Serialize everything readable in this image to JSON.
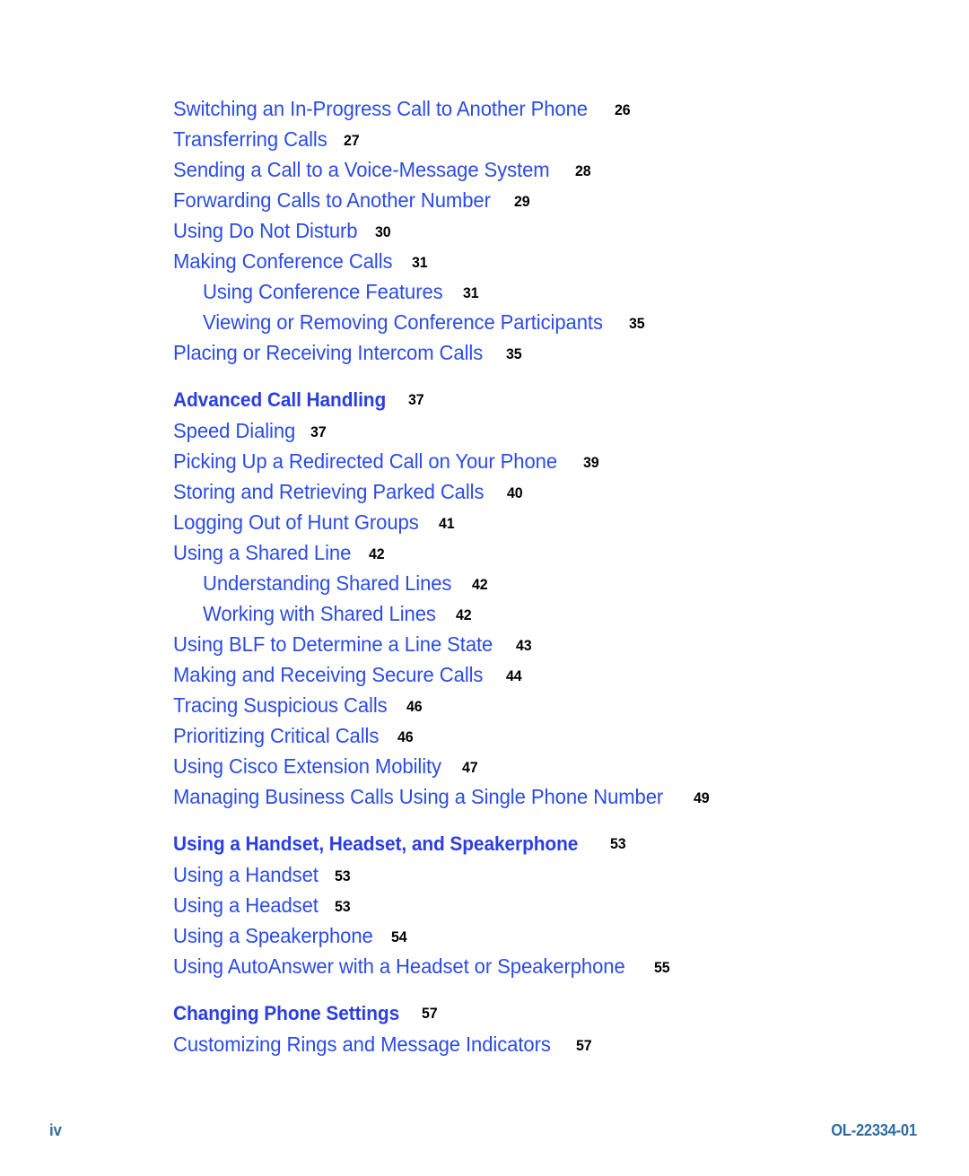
{
  "document": {
    "footer": {
      "page_label": "iv",
      "doc_id": "OL-22334-01"
    },
    "colors": {
      "entry_blue": "#2b4be8",
      "heading_blue": "#2b3fe0",
      "page_number_black": "#000000",
      "footer_blue": "#2e6ca4"
    }
  },
  "toc": {
    "entries": [
      {
        "title": "Switching an In-Progress Call to Another Phone",
        "page": "26",
        "level": 1,
        "heading": false
      },
      {
        "title": "Transferring Calls",
        "page": "27",
        "level": 1,
        "heading": false
      },
      {
        "title": "Sending a Call to a Voice-Message System",
        "page": "28",
        "level": 1,
        "heading": false
      },
      {
        "title": "Forwarding Calls to Another Number",
        "page": "29",
        "level": 1,
        "heading": false
      },
      {
        "title": "Using Do Not Disturb",
        "page": "30",
        "level": 1,
        "heading": false
      },
      {
        "title": "Making Conference Calls",
        "page": "31",
        "level": 1,
        "heading": false
      },
      {
        "title": "Using Conference Features",
        "page": "31",
        "level": 2,
        "heading": false
      },
      {
        "title": "Viewing or Removing Conference Participants",
        "page": "35",
        "level": 2,
        "heading": false
      },
      {
        "title": "Placing or Receiving Intercom Calls",
        "page": "35",
        "level": 1,
        "heading": false
      },
      {
        "title": "Advanced Call Handling",
        "page": "37",
        "level": 1,
        "heading": true
      },
      {
        "title": "Speed Dialing",
        "page": "37",
        "level": 1,
        "heading": false
      },
      {
        "title": "Picking Up a Redirected Call on Your Phone",
        "page": "39",
        "level": 1,
        "heading": false
      },
      {
        "title": "Storing and Retrieving Parked Calls",
        "page": "40",
        "level": 1,
        "heading": false
      },
      {
        "title": "Logging Out of Hunt Groups",
        "page": "41",
        "level": 1,
        "heading": false
      },
      {
        "title": "Using a Shared Line",
        "page": "42",
        "level": 1,
        "heading": false
      },
      {
        "title": "Understanding Shared Lines",
        "page": "42",
        "level": 2,
        "heading": false
      },
      {
        "title": "Working with Shared Lines",
        "page": "42",
        "level": 2,
        "heading": false
      },
      {
        "title": "Using BLF to Determine a Line State",
        "page": "43",
        "level": 1,
        "heading": false
      },
      {
        "title": "Making and Receiving Secure Calls",
        "page": "44",
        "level": 1,
        "heading": false
      },
      {
        "title": "Tracing Suspicious Calls",
        "page": "46",
        "level": 1,
        "heading": false
      },
      {
        "title": "Prioritizing Critical Calls",
        "page": "46",
        "level": 1,
        "heading": false
      },
      {
        "title": "Using Cisco Extension Mobility",
        "page": "47",
        "level": 1,
        "heading": false
      },
      {
        "title": "Managing Business Calls Using a Single Phone Number",
        "page": "49",
        "level": 1,
        "heading": false
      },
      {
        "title": "Using a Handset, Headset, and Speakerphone",
        "page": "53",
        "level": 1,
        "heading": true
      },
      {
        "title": "Using a Handset",
        "page": "53",
        "level": 1,
        "heading": false
      },
      {
        "title": "Using a Headset",
        "page": "53",
        "level": 1,
        "heading": false
      },
      {
        "title": "Using a Speakerphone",
        "page": "54",
        "level": 1,
        "heading": false
      },
      {
        "title": "Using AutoAnswer with a Headset or Speakerphone",
        "page": "55",
        "level": 1,
        "heading": false
      },
      {
        "title": "Changing Phone Settings",
        "page": "57",
        "level": 1,
        "heading": true
      },
      {
        "title": "Customizing Rings and Message Indicators",
        "page": "57",
        "level": 1,
        "heading": false
      }
    ]
  }
}
